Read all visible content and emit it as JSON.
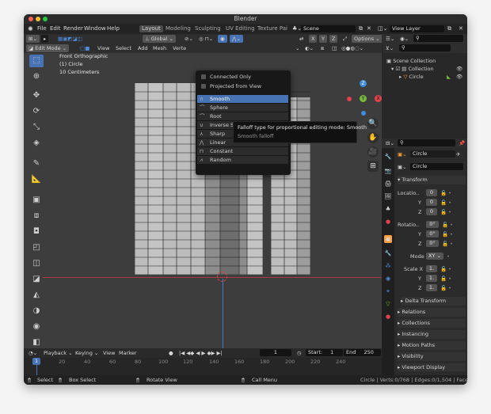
{
  "window": {
    "title": "Blender"
  },
  "menu": {
    "items": [
      "File",
      "Edit",
      "Render",
      "Window",
      "Help"
    ]
  },
  "workspaces": [
    "Layout",
    "Modeling",
    "Sculpting",
    "UV Editing",
    "Texture Pai"
  ],
  "scene_field": "Scene",
  "view_layer_field": "View Layer",
  "header3d": {
    "mode": "Edit Mode",
    "menus": [
      "View",
      "Select",
      "Add",
      "Mesh",
      "Verte"
    ],
    "orientation": "Global",
    "axes": [
      "X",
      "Y",
      "Z"
    ],
    "options": "Options"
  },
  "viewport_info": {
    "line1": "Front Orthographic",
    "line2": "(1) Circle",
    "line3": "10 Centimeters"
  },
  "falloff_menu": {
    "checks": [
      "Connected Only",
      "Projected from View"
    ],
    "items": [
      {
        "label": "Smooth",
        "icon": "∩"
      },
      {
        "label": "Sphere",
        "icon": "⌒"
      },
      {
        "label": "Root",
        "icon": "⌒"
      },
      {
        "label": "Inverse S",
        "icon": "∪"
      },
      {
        "label": "Sharp",
        "icon": "⋏"
      },
      {
        "label": "Linear",
        "icon": "⋀"
      },
      {
        "label": "Constant",
        "icon": "⊓"
      },
      {
        "label": "Random",
        "icon": "⩘"
      }
    ],
    "selected": "Smooth"
  },
  "tooltip": {
    "title": "Falloff type for proportional editing mode:",
    "value": "Smooth",
    "desc": "Smooth falloff"
  },
  "outliner": {
    "root": "Scene Collection",
    "collection": "Collection",
    "object": "Circle"
  },
  "properties": {
    "object_name": "Circle",
    "data_name": "Circle",
    "transform_label": "Transform",
    "location_label": "Locatio..",
    "location": [
      "0",
      "0",
      "0"
    ],
    "rotation_label": "Rotatio..",
    "rotation": [
      "0°",
      "0°",
      "0°"
    ],
    "mode_label": "Mode",
    "mode_value": "XY ⌄",
    "scale_label": "Scale X",
    "scale": [
      "1.",
      "1.",
      "1."
    ],
    "axis_y": "Y",
    "axis_z": "Z",
    "delta": "Delta Transform",
    "panels": [
      "Relations",
      "Collections",
      "Instancing",
      "Motion Paths",
      "Visibility",
      "Viewport Display"
    ]
  },
  "timeline": {
    "menus": [
      "Playback ⌄",
      "Keying ⌄",
      "View",
      "Marker"
    ],
    "current_frame": "1",
    "start_label": "Start:",
    "start": "1",
    "end_label": "End",
    "end": "250",
    "ruler": [
      "1",
      "20",
      "40",
      "60",
      "80",
      "100",
      "120",
      "140",
      "160",
      "180",
      "200",
      "220",
      "240"
    ]
  },
  "status": {
    "select": "Select",
    "box_select": "Box Select",
    "rotate": "Rotate View",
    "call_menu": "Call Menu",
    "stats": "Circle | Verts:0/768 | Edges:0/1,504 | Faces:0/"
  },
  "colors": {
    "accent": "#4772b3",
    "active_tool": "#4772b3",
    "x_axis": "#e0434b",
    "y_axis": "#77b83c",
    "z_axis": "#3f8cdb",
    "mesh_light": "#bebebe",
    "mesh_dark": "#8d8d8d",
    "mesh_shade": "#696969"
  }
}
